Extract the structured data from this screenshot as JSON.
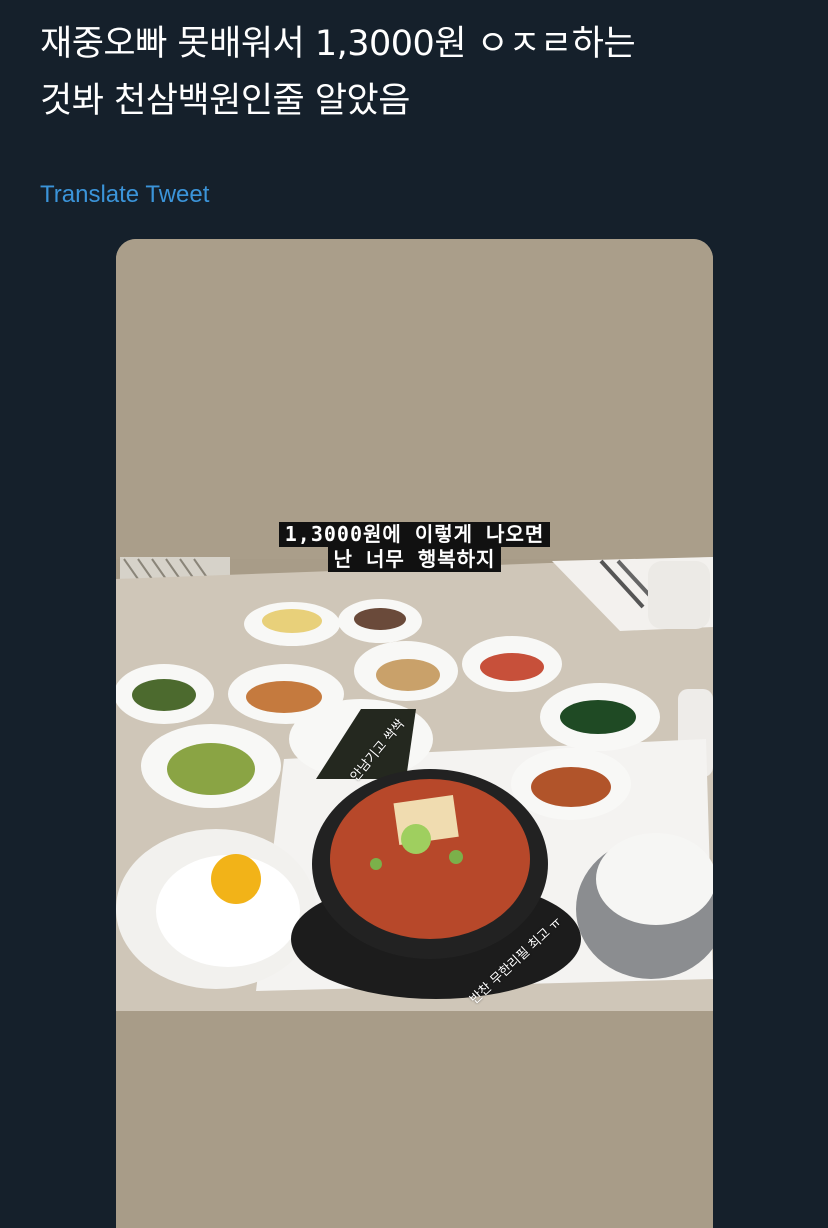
{
  "tweet": {
    "text_line1": "재중오빠 못배워서 1,3000원 ㅇㅈㄹ하는",
    "text_line2": "것봐 천삼백원인줄 알았음",
    "translate_label": "Translate Tweet"
  },
  "story": {
    "caption_line1": "1,3000원에 이렇게 나오면",
    "caption_line2": "난 너무 행복하지",
    "seaweed_note": "안남기고 싹싹",
    "refill_note": "반찬 무한리필 최고 ㅠ"
  },
  "colors": {
    "background": "#15202b",
    "link": "#3b94d9",
    "text": "#ffffff",
    "wall": "#a89c88"
  }
}
